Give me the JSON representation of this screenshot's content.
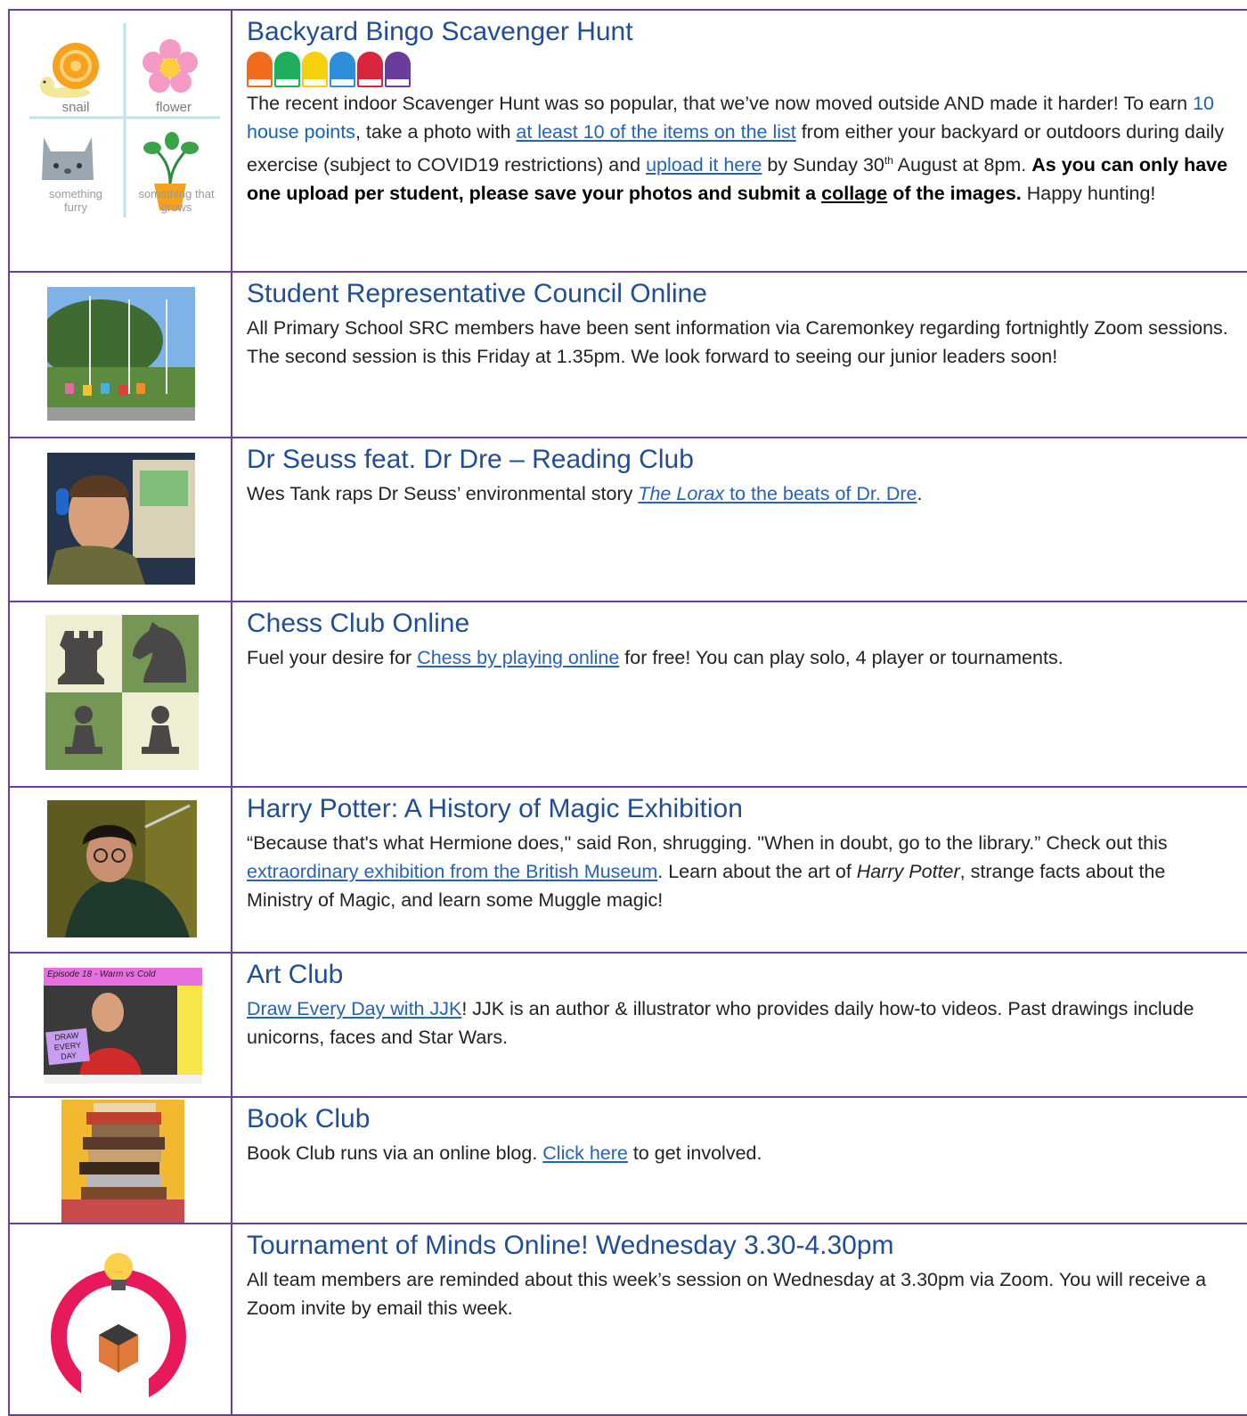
{
  "rows": [
    {
      "id": "bingo",
      "title": "Backyard Bingo Scavenger Hunt",
      "image_alt": "Scavenger hunt bingo card",
      "bingo_labels": [
        "snail",
        "flower",
        "something furry",
        "something that grows"
      ],
      "house_colors": [
        "#f26a1b",
        "#1fae5c",
        "#f4d10c",
        "#2e8fd8",
        "#d7263d",
        "#6a3d9a"
      ],
      "text": {
        "p1": "The recent indoor Scavenger Hunt was so popular, that we’ve now moved outside AND made it harder! To earn ",
        "points": "10 house points",
        "p2": ", take a photo with ",
        "link1": "at least 10 of the items on the list",
        "p3": " from either your backyard or outdoors during daily exercise (subject to COVID19 restrictions) and ",
        "link2": "upload it here",
        "p4": " by Sunday 30",
        "sup": "th",
        "p5": " August at 8pm. ",
        "bold1": "As you can only have one upload per student, please save your photos and submit a ",
        "bold_u": "collage",
        "bold2": " of the images.",
        "p6": " Happy hunting!"
      }
    },
    {
      "id": "src",
      "title": "Student Representative Council Online",
      "image_alt": "School flags photo",
      "text": {
        "p1": "All Primary School SRC members have been sent information via Caremonkey regarding fortnightly Zoom sessions. The second session is this Friday at 1.35pm. We look forward to seeing our junior leaders soon!"
      }
    },
    {
      "id": "seuss",
      "title": "Dr Seuss feat. Dr Dre – Reading Club",
      "image_alt": "Wes Tank reading",
      "text": {
        "p1": "Wes Tank raps Dr Seuss’ environmental story ",
        "link_it": "The Lorax",
        "link": " to the beats of Dr. Dre",
        "p2": "."
      }
    },
    {
      "id": "chess",
      "title": "Chess Club Online",
      "image_alt": "Chess pieces",
      "text": {
        "p1": "Fuel your desire for ",
        "link": "Chess by playing online",
        "p2": " for free! You can play solo, 4 player or tournaments."
      }
    },
    {
      "id": "potter",
      "title": "Harry Potter: A History of Magic Exhibition",
      "image_alt": "Harry Potter painting",
      "text": {
        "p1": "“Because that's what Hermione does,\" said Ron, shrugging. \"When in doubt, go to the library.” Check out this ",
        "link": "extraordinary exhibition from the British Museum",
        "p2": ". Learn about the art of ",
        "it": "Harry Potter",
        "p3": ", strange facts about the Ministry of Magic, and learn some Muggle magic!"
      }
    },
    {
      "id": "art",
      "title": "Art Club",
      "image_alt": "Draw Every Day with JJK",
      "thumb_banner": "Episode 18 - Warm vs Cold",
      "thumb_sign": [
        "DRAW",
        "EVERY",
        "DAY"
      ],
      "text": {
        "link": "Draw Every Day with JJK",
        "p1": "! JJK is an author & illustrator who provides daily how-to videos. Past drawings include unicorns, faces and Star Wars."
      }
    },
    {
      "id": "book",
      "title": "Book Club",
      "image_alt": "Stack of books",
      "text": {
        "p1": "Book Club runs via an online blog. ",
        "link": "Click here",
        "p2": " to get involved."
      }
    },
    {
      "id": "tom",
      "title": "Tournament of Minds Online! Wednesday 3.30-4.30pm",
      "image_alt": "Tournament of Minds logo",
      "text": {
        "p1": "All team members are reminded about this week’s session on Wednesday at 3.30pm via Zoom. You will receive a Zoom invite by email this week."
      }
    }
  ],
  "colors": {
    "border": "#6b3fa0",
    "title": "#1f4e96",
    "link": "#2463b8"
  }
}
